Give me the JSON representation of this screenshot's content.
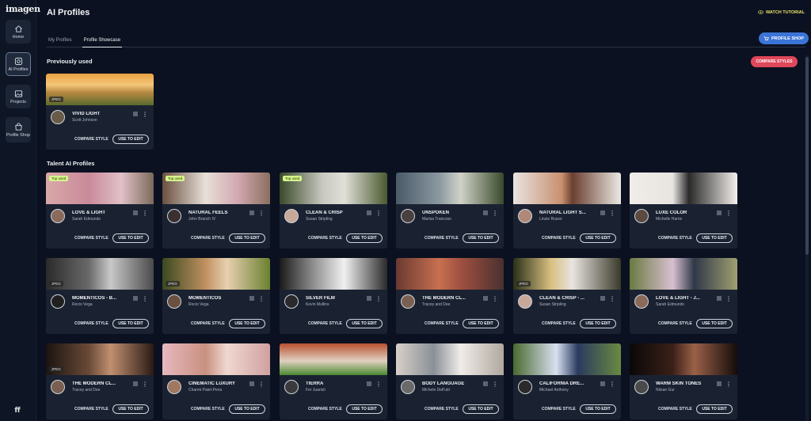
{
  "app": {
    "logo": "imagen",
    "title": "AI Profiles"
  },
  "sidebar": {
    "items": [
      {
        "label": "Home",
        "icon": "home-icon"
      },
      {
        "label": "AI Profiles",
        "icon": "ai-profiles-icon"
      },
      {
        "label": "Projects",
        "icon": "projects-icon"
      },
      {
        "label": "Profile Shop",
        "icon": "shop-icon"
      }
    ],
    "user_initials": "ff"
  },
  "header": {
    "watch_tutorial": "WATCH TUTORIAL",
    "tabs": [
      {
        "label": "My Profiles"
      },
      {
        "label": "Profile Showcase"
      }
    ],
    "profile_shop": "PROFILE SHOP",
    "compare_styles": "COMPARE STYLES"
  },
  "sections": {
    "previously_used": "Previously used",
    "talent": "Talent AI Profiles"
  },
  "card_labels": {
    "compare": "COMPARE STYLE",
    "use": "USE TO EDIT",
    "top_used": "Top used",
    "jpeg": "JPEG"
  },
  "cards": [
    {
      "name": "VIVID LIGHT",
      "author": "Scott Johnson"
    },
    {
      "name": "LOVE & LIGHT",
      "author": "Sarah Edmunds"
    },
    {
      "name": "NATURAL FEELS",
      "author": "John Branch IV"
    },
    {
      "name": "CLEAN & CRISP",
      "author": "Susan Stripling"
    },
    {
      "name": "UNSPOKEN",
      "author": "Marisa Trancoso"
    },
    {
      "name": "NATURAL LIGHT S...",
      "author": "Linzie Russo"
    },
    {
      "name": "LUXE COLOR",
      "author": "Michelle Harris"
    },
    {
      "name": "MOMENTICOS - B...",
      "author": "Rocio Vega"
    },
    {
      "name": "MOMENTICOS",
      "author": "Rocio Vega"
    },
    {
      "name": "SILVER FILM",
      "author": "Kevin Mullins"
    },
    {
      "name": "THE MODERN CL...",
      "author": "Tracey and Dee"
    },
    {
      "name": "CLEAN & CRISP - ...",
      "author": "Susan Stripling"
    },
    {
      "name": "LOVE & LIGHT - J...",
      "author": "Sarah Edmunds"
    },
    {
      "name": "THE MODERN CL...",
      "author": "Tracey and Dee"
    },
    {
      "name": "CINEMATIC LUXURY",
      "author": "Charmi Patel-Pena"
    },
    {
      "name": "TIERRA",
      "author": "Fer Juaristi"
    },
    {
      "name": "BODY LANGUAGE",
      "author": "Michele Dell'utri"
    },
    {
      "name": "CALIFORNIA DRE...",
      "author": "Michael Anthony"
    },
    {
      "name": "WARM SKIN TONES",
      "author": "Nitzan Gur"
    }
  ],
  "colors": {
    "accent_blue": "#3b74d6",
    "accent_red": "#e0475a",
    "tutorial_yellow": "#e8e46a",
    "badge_green": "#d6f58a"
  }
}
